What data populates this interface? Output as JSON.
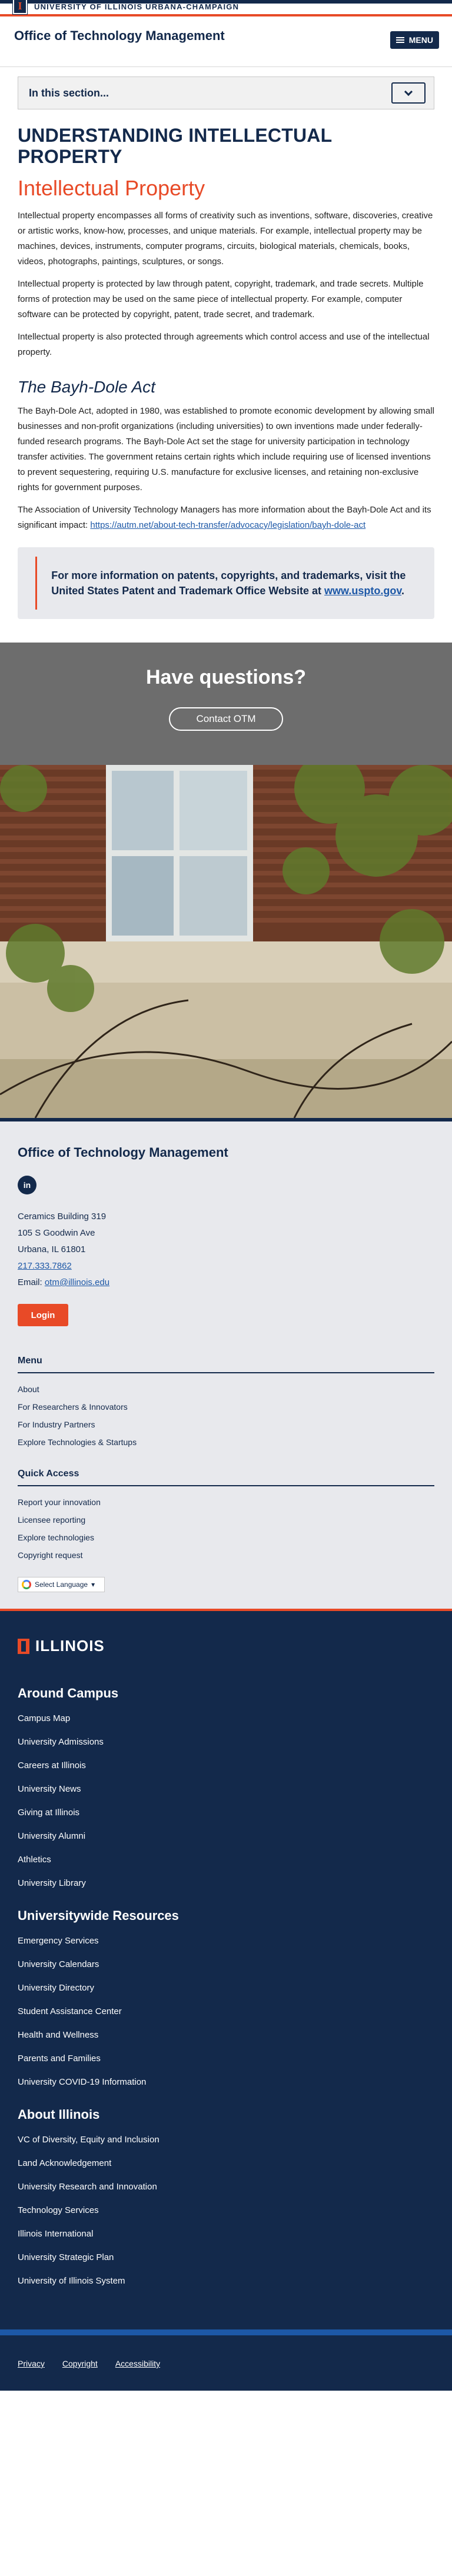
{
  "campus": {
    "name": "UNIVERSITY OF ILLINOIS URBANA-CHAMPAIGN",
    "mark": "I"
  },
  "header": {
    "title": "Office of Technology Management",
    "menu_label": "MENU"
  },
  "section_nav": {
    "label": "In this section..."
  },
  "main": {
    "title": "UNDERSTANDING INTELLECTUAL PROPERTY",
    "subtitle": "Intellectual Property",
    "paragraphs": [
      "Intellectual property encompasses all forms of creativity such as inventions, software, discoveries, creative or artistic works, know-how, processes, and unique materials. For example, intellectual property may be machines, devices, instruments, computer programs, circuits, biological materials, chemicals, books, videos, photographs, paintings, sculptures, or songs.",
      "Intellectual property is protected by law through patent, copyright, trademark, and trade secrets. Multiple forms of protection may be used on the same piece of intellectual property. For example, computer software can be protected by copyright, patent, trade secret, and trademark.",
      "Intellectual property is also protected through agreements which control access and use of the intellectual property."
    ],
    "bayh_title": "The Bayh-Dole Act",
    "bayh_paragraph": "The Bayh-Dole Act, adopted in 1980, was established to promote economic development by allowing small businesses and non-profit organizations (including universities) to own inventions made under federally-funded research programs. The Bayh-Dole Act set the stage for university participation in technology transfer activities. The government retains certain rights which include requiring use of licensed inventions to prevent sequestering, requiring U.S. manufacture for exclusive licenses, and retaining non-exclusive rights for government purposes.",
    "autm_text": "The Association of University Technology Managers has more information about the Bayh-Dole Act and its significant impact: ",
    "autm_link": "https://autm.net/about-tech-transfer/advocacy/legislation/bayh-dole-act",
    "callout_text": "For more information on patents, copyrights, and trademarks, visit the United States Patent and Trademark Office Website at ",
    "callout_link": "www.uspto.gov",
    "callout_end": "."
  },
  "questions": {
    "title": "Have questions?",
    "button": "Contact OTM"
  },
  "contact": {
    "title": "Office of Technology Management",
    "social": "in",
    "address_line1": "Ceramics Building 319",
    "address_line2": "105 S Goodwin Ave",
    "address_line3": "Urbana, IL 61801",
    "phone": "217.333.7862",
    "email_label": "Email: ",
    "email": "otm@illinois.edu",
    "login": "Login",
    "menu_title": "Menu",
    "menu_items": [
      "About",
      "For Researchers & Innovators",
      "For Industry Partners",
      "Explore Technologies & Startups"
    ],
    "quick_title": "Quick Access",
    "quick_items": [
      "Report your innovation",
      "Licensee reporting",
      "Explore technologies",
      "Copyright request"
    ],
    "language": "Select Language"
  },
  "dark_footer": {
    "logo_text": "ILLINOIS",
    "around_title": "Around Campus",
    "around_items": [
      "Campus Map",
      "University Admissions",
      "Careers at Illinois",
      "University News",
      "Giving at Illinois",
      "University Alumni",
      "Athletics",
      "University Library"
    ],
    "wide_title": "Universitywide Resources",
    "wide_items": [
      "Emergency Services",
      "University Calendars",
      "University Directory",
      "Student Assistance Center",
      "Health and Wellness",
      "Parents and Families",
      "University COVID-19 Information"
    ],
    "about_title": "About Illinois",
    "about_items": [
      "VC of Diversity, Equity and Inclusion",
      "Land Acknowledgement",
      "University Research and Innovation",
      "Technology Services",
      "Illinois International",
      "University Strategic Plan",
      "University of Illinois System"
    ]
  },
  "bottom_links": [
    "Privacy",
    "Copyright",
    "Accessibility"
  ],
  "colors": {
    "navy": "#13294B",
    "orange": "#E84A27",
    "link": "#1D58A7"
  }
}
